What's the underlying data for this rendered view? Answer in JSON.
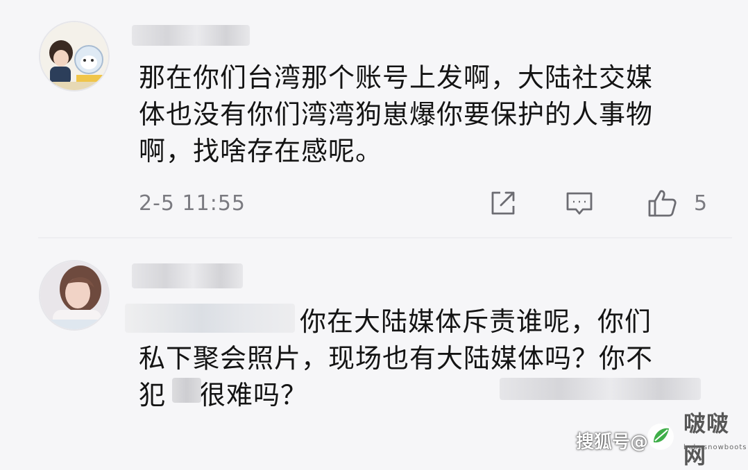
{
  "comments": [
    {
      "text_lines": [
        "那在你们台湾那个账号上发啊，大陆社交媒",
        "体也没有你们湾湾狗崽爆你要保护的人事物",
        "啊，找啥存在感呢。"
      ],
      "timestamp": "2-5 11:55",
      "like_count": "5",
      "icons": {
        "share": "share-icon",
        "comment": "comment-icon",
        "like": "thumbs-up-icon"
      }
    },
    {
      "text_line_1": "你在大陆媒体斥责谁呢，你们",
      "text_line_2": "私下聚会照片，现场也有大陆媒体吗？你不",
      "text_line_3_a": "犯",
      "text_line_3_b": "很难吗？"
    }
  ],
  "watermark": {
    "platform": "搜狐号@",
    "site": "啵啵网",
    "site_sub": "bobosnowboots"
  },
  "colors": {
    "background": "#f6f6f8",
    "text": "#141414",
    "meta": "#7a7a80"
  }
}
